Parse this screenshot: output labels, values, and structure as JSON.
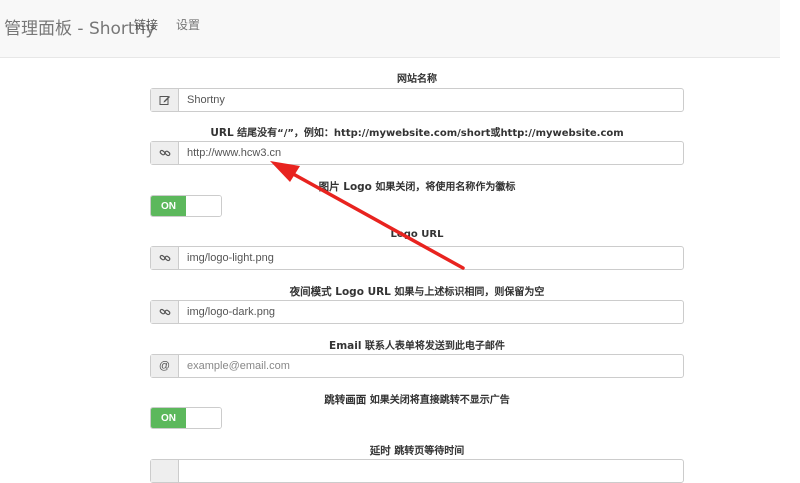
{
  "navbar": {
    "brand": "管理面板 - Shortny",
    "links": [
      "链接",
      "设置"
    ]
  },
  "form": {
    "site_name": {
      "label": "网站名称",
      "value": "Shortny",
      "icon": "edit-icon"
    },
    "url": {
      "label_bold": "URL",
      "label_rest": " 结尾没有“/”，例如：http://mywebsite.com/short或http://mywebsite.com",
      "value": "http://www.hcw3.cn",
      "icon": "link-icon"
    },
    "logo_toggle": {
      "label_bold": "图片 Logo",
      "label_rest": " 如果关闭，将使用名称作为徽标",
      "state": "ON"
    },
    "logo_url": {
      "label": "Logo URL",
      "value": "img/logo-light.png",
      "icon": "link-icon"
    },
    "dark_logo": {
      "label_bold": "夜间模式 Logo URL",
      "label_rest": " 如果与上述标识相同，则保留为空",
      "value": "img/logo-dark.png",
      "icon": "link-icon"
    },
    "email": {
      "label_bold": "Email",
      "label_rest": " 联系人表单将发送到此电子邮件",
      "placeholder": "example@email.com",
      "addon": "@"
    },
    "redirect_toggle": {
      "label_bold": "跳转画面",
      "label_rest": " 如果关闭将直接跳转不显示广告",
      "state": "ON"
    },
    "delay": {
      "label_bold": "延时",
      "label_rest": " 跳转页等待时间"
    }
  },
  "colors": {
    "toggle_on": "#5cb85c",
    "annotation_arrow": "#e8231f"
  }
}
